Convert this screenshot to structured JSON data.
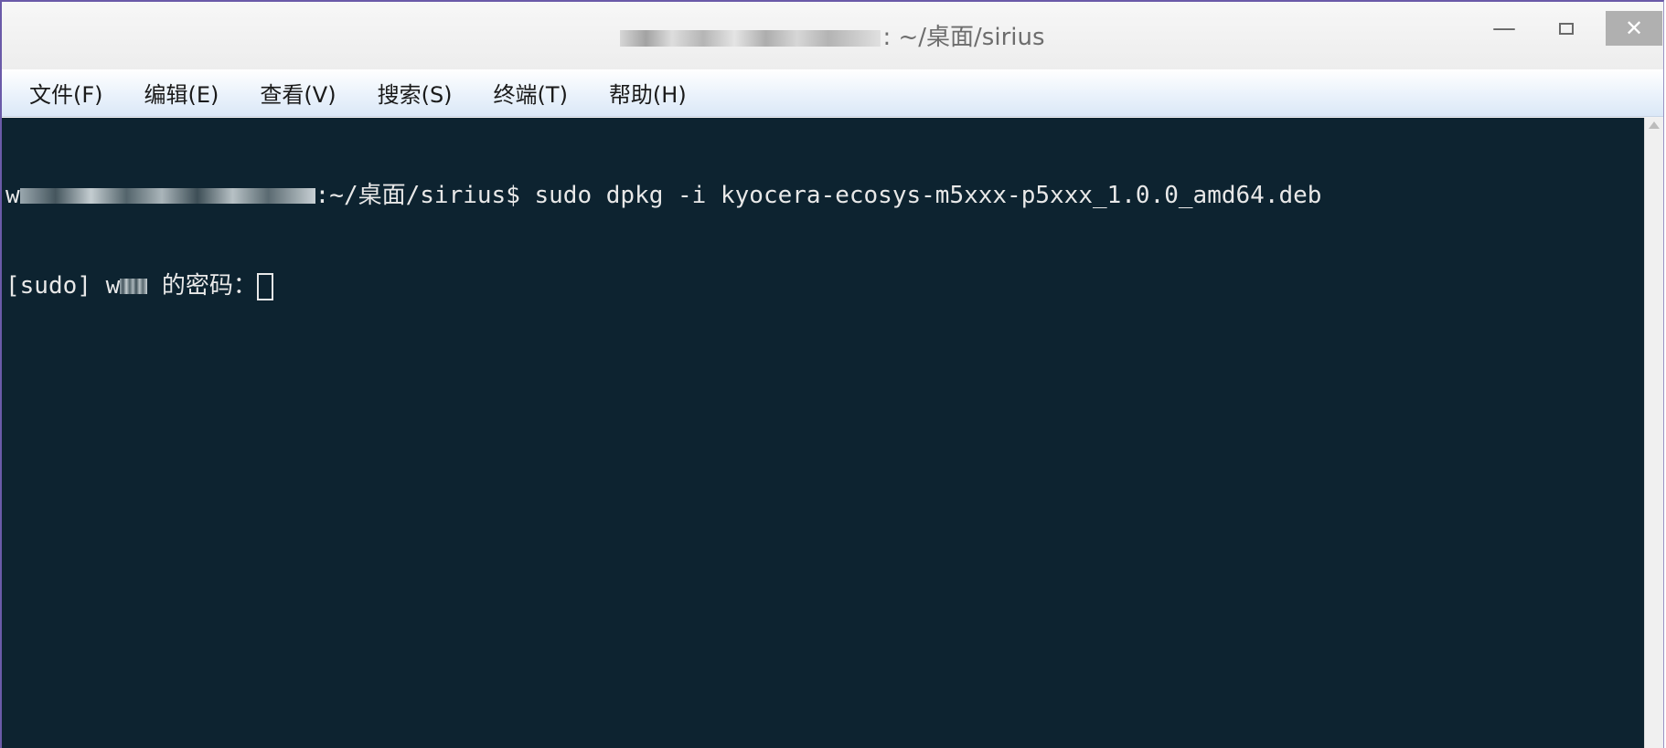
{
  "window": {
    "title_suffix": ": ~/桌面/sirius",
    "minimize_glyph": "—",
    "close_glyph": "✕"
  },
  "menu": {
    "items": [
      {
        "label": "文件(F)"
      },
      {
        "label": "编辑(E)"
      },
      {
        "label": "查看(V)"
      },
      {
        "label": "搜索(S)"
      },
      {
        "label": "终端(T)"
      },
      {
        "label": "帮助(H)"
      }
    ]
  },
  "terminal": {
    "line1_user_start": "w",
    "line1_text": ":~/桌面/sirius$ sudo dpkg -i kyocera-ecosys-m5xxx-p5xxx_1.0.0_amd64.deb",
    "line2_prefix": "[sudo] ",
    "line2_user_start": "w",
    "line2_text": " 的密码："
  },
  "colors": {
    "terminal_bg": "#0d2330",
    "terminal_fg": "#e8e8e8",
    "menubar_bg": "#eaf2fb",
    "close_button_bg": "#b0b0b0"
  }
}
